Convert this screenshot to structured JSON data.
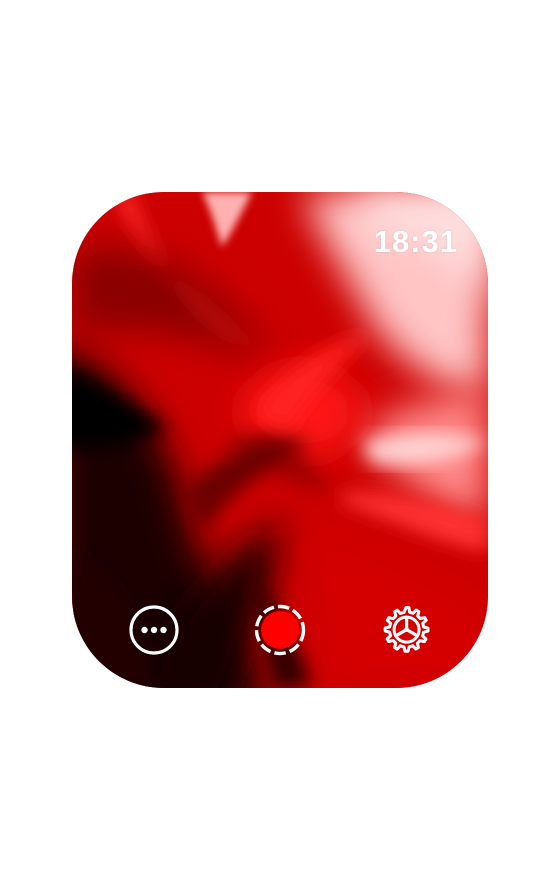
{
  "status_bar": {
    "time": "18:31"
  },
  "wallpaper": {
    "style": "red-swirl",
    "colors": {
      "base": "#c80000",
      "bright": "#ff1a1a",
      "highlight": "#ffd0d0",
      "shadow": "#000000"
    }
  },
  "toolbar": {
    "buttons": [
      {
        "icon": "more-options-icon"
      },
      {
        "icon": "record-icon",
        "fill": "#ff0000"
      },
      {
        "icon": "settings-gear-icon"
      }
    ]
  }
}
